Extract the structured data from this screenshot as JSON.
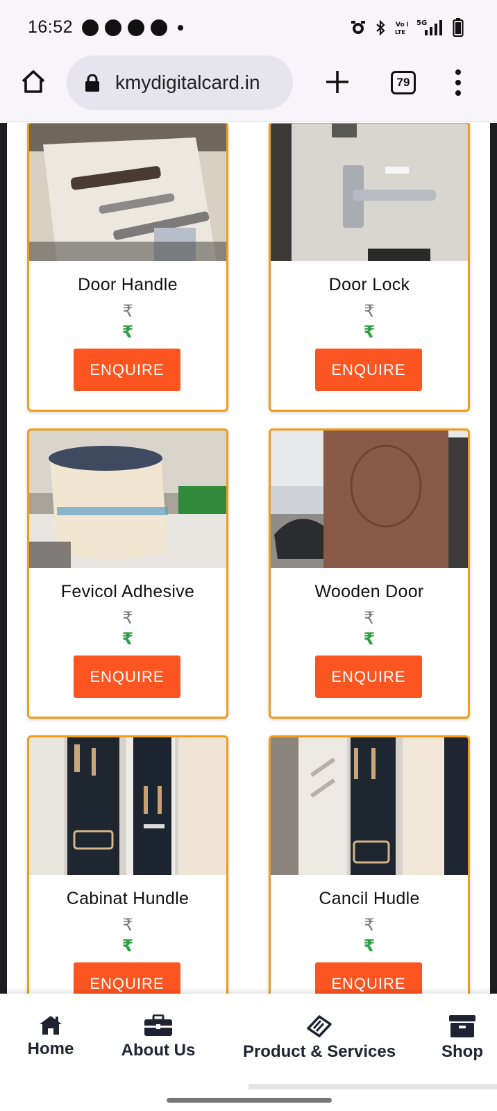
{
  "status_bar": {
    "time": "16:52",
    "notification_icons": [
      "chat-bubble-icon",
      "app-notification-icon",
      "app-a-icon",
      "trophy-icon"
    ],
    "system_icons": [
      "alarm-icon",
      "bluetooth-icon",
      "volte-icon",
      "5g-signal-icon",
      "battery-icon"
    ],
    "volte_label": "Vo LTE",
    "network_label": "5G"
  },
  "browser": {
    "url": "kmydigitalcard.in",
    "tab_count": "79"
  },
  "products": [
    {
      "name": "Door Handle",
      "mrp_symbol": "₹",
      "price_symbol": "₹",
      "button": "ENQUIRE"
    },
    {
      "name": "Door Lock",
      "mrp_symbol": "₹",
      "price_symbol": "₹",
      "button": "ENQUIRE"
    },
    {
      "name": "Fevicol Adhesive",
      "mrp_symbol": "₹",
      "price_symbol": "₹",
      "button": "ENQUIRE"
    },
    {
      "name": "Wooden Door",
      "mrp_symbol": "₹",
      "price_symbol": "₹",
      "button": "ENQUIRE"
    },
    {
      "name": "Cabinat Hundle",
      "mrp_symbol": "₹",
      "price_symbol": "₹",
      "button": "ENQUIRE"
    },
    {
      "name": "Cancil Hudle",
      "mrp_symbol": "₹",
      "price_symbol": "₹",
      "button": "ENQUIRE"
    }
  ],
  "bottom_nav": [
    {
      "label": "Home",
      "icon": "home-icon"
    },
    {
      "label": "About Us",
      "icon": "briefcase-icon"
    },
    {
      "label": "Product & Services",
      "icon": "tag-icon"
    },
    {
      "label": "Shop",
      "icon": "archive-box-icon"
    }
  ],
  "colors": {
    "card_border": "#f39a16",
    "enquire_button": "#fd5521",
    "price_green": "#2f9e44",
    "nav_text": "#1f2233"
  }
}
